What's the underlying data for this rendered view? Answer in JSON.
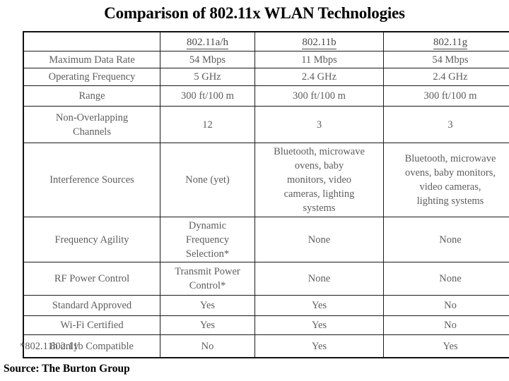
{
  "title": "Comparison of 802.11x WLAN Technologies",
  "footnote": "*802.11h only",
  "source": "Source: The Burton Group",
  "table": {
    "columns": [
      {
        "label": ""
      },
      {
        "label": "802.11a/h"
      },
      {
        "label": "802.11b"
      },
      {
        "label": "802.11g"
      }
    ],
    "rows": [
      {
        "label": "Maximum Data Rate",
        "a": "54 Mbps",
        "b": "11 Mbps",
        "g": "54 Mbps"
      },
      {
        "label": "Operating Frequency",
        "a": "5 GHz",
        "b": "2.4 GHz",
        "g": "2.4 GHz"
      },
      {
        "label": "Range",
        "a": "300 ft/100 m",
        "b": "300 ft/100 m",
        "g": "300 ft/100 m"
      },
      {
        "label": "Non-Overlapping\nChannels",
        "a": "12",
        "b": "3",
        "g": "3"
      },
      {
        "label": "Interference Sources",
        "a": "None (yet)",
        "b": "Bluetooth, microwave\novens, baby\nmonitors, video\ncameras, lighting\nsystems",
        "g": "Bluetooth, microwave\novens, baby monitors,\nvideo cameras,\nlighting systems"
      },
      {
        "label": "Frequency Agility",
        "a": "Dynamic\nFrequency\nSelection*",
        "b": "None",
        "g": "None"
      },
      {
        "label": "RF Power Control",
        "a": "Transmit Power\nControl*",
        "b": "None",
        "g": "None"
      },
      {
        "label": "Standard Approved",
        "a": "Yes",
        "b": "Yes",
        "g": "No"
      },
      {
        "label": "Wi-Fi Certified",
        "a": "Yes",
        "b": "Yes",
        "g": "No"
      },
      {
        "label": "802.11b Compatible",
        "a": "No",
        "b": "Yes",
        "g": "Yes"
      }
    ]
  },
  "colors": {
    "text": "#5d5d5d",
    "heading": "#000000",
    "border": "#1a1a1a"
  }
}
